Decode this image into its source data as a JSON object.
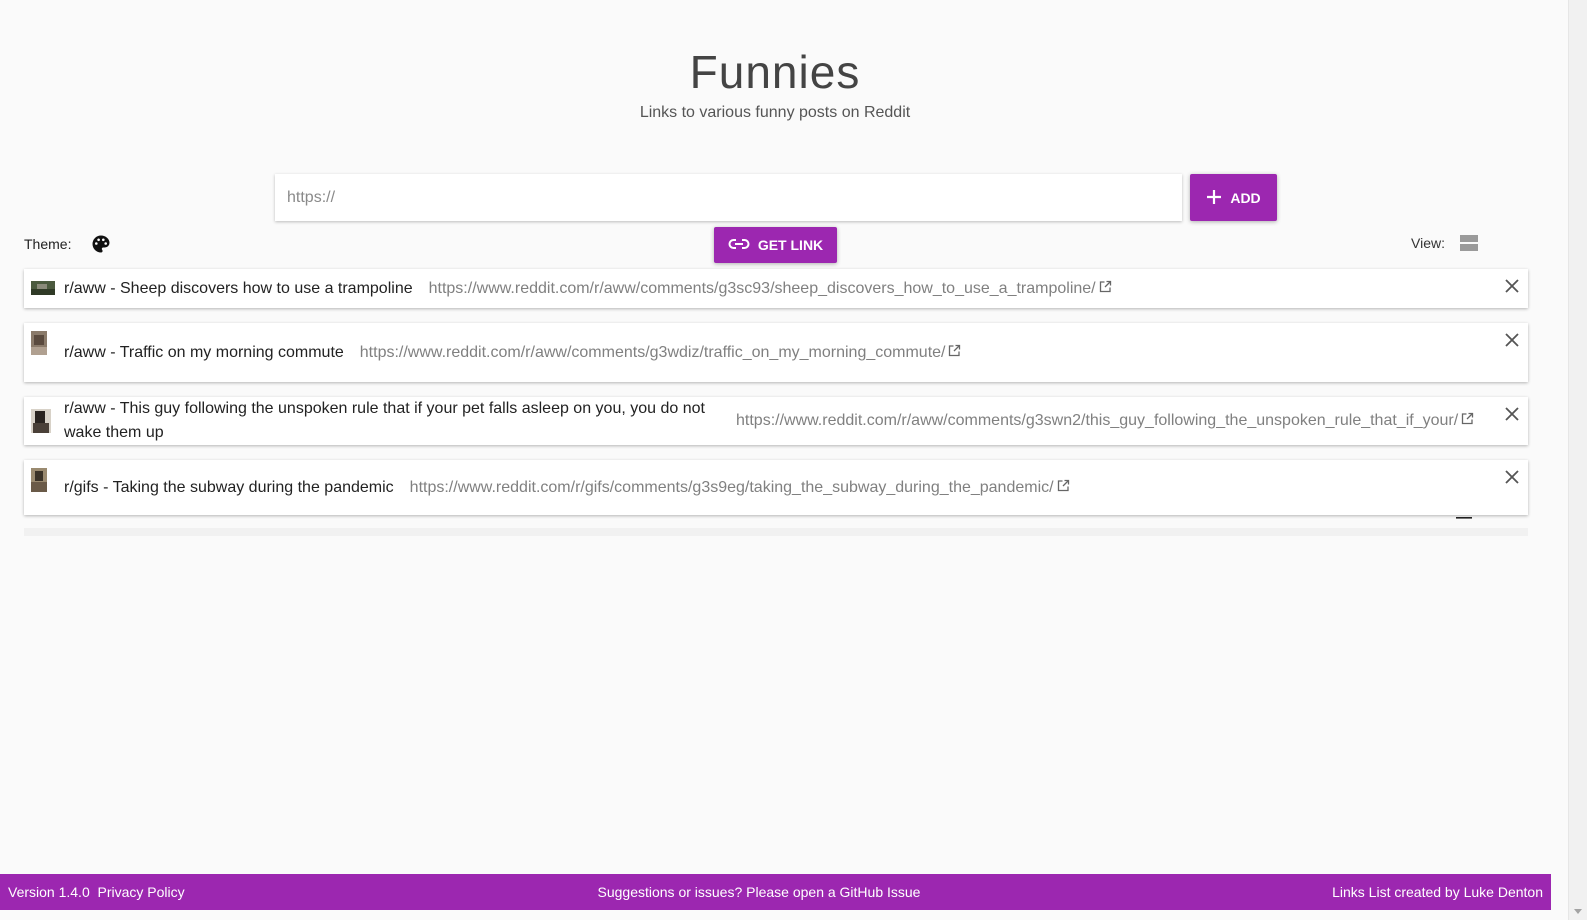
{
  "header": {
    "title": "Funnies",
    "subtitle": "Links to various funny posts on Reddit"
  },
  "input": {
    "placeholder": "https://",
    "value": ""
  },
  "buttons": {
    "add_label": "ADD",
    "get_link_label": "GET LINK"
  },
  "theme": {
    "label": "Theme:",
    "icon": "palette-icon"
  },
  "view": {
    "label": "View:",
    "icons": [
      "view-cards-icon",
      "view-list-icon"
    ]
  },
  "links": [
    {
      "title": "r/aww - Sheep discovers how to use a trampoline",
      "url": "https://www.reddit.com/r/aww/comments/g3sc93/sheep_discovers_how_to_use_a_trampoline/"
    },
    {
      "title": "r/aww - Traffic on my morning commute",
      "url": "https://www.reddit.com/r/aww/comments/g3wdiz/traffic_on_my_morning_commute/"
    },
    {
      "title": "r/aww - This guy following the unspoken rule that if your pet falls asleep on you, you do not wake them up",
      "url": "https://www.reddit.com/r/aww/comments/g3swn2/this_guy_following_the_unspoken_rule_that_if_your/"
    },
    {
      "title": "r/gifs - Taking the subway during the pandemic",
      "url": "https://www.reddit.com/r/gifs/comments/g3s9eg/taking_the_subway_during_the_pandemic/"
    }
  ],
  "footer": {
    "version": "Version 1.4.0",
    "privacy": "Privacy Policy",
    "suggestions": "Suggestions or issues? Please open a GitHub Issue",
    "credit": "Links List created by Luke Denton"
  },
  "colors": {
    "accent": "#9c27b0",
    "background": "#fafafa"
  }
}
